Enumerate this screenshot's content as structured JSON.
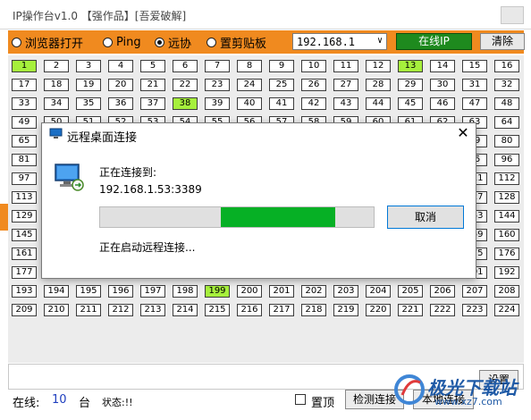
{
  "window": {
    "title": "IP操作台v1.0    【强作品】[吾爱破解]"
  },
  "toolbar": {
    "options": [
      {
        "label": "浏览器打开",
        "selected": false
      },
      {
        "label": "Ping",
        "selected": false
      },
      {
        "label": "远协",
        "selected": true
      },
      {
        "label": "置剪贴板",
        "selected": false
      }
    ],
    "ip_value": "192.168.1",
    "online_label": "在线IP",
    "clear_label": "清除"
  },
  "grid": {
    "online": [
      1,
      13,
      38,
      199
    ]
  },
  "status": {
    "online_label": "在线:",
    "online_count": "10",
    "unit": "台",
    "state_label": "状态:!!",
    "pin_label": "置顶",
    "detect_label": "检测连接",
    "local_label": "本地连接",
    "settings_label": "设置"
  },
  "dialog": {
    "title": "远程桌面连接",
    "connecting_label": "正在连接到:",
    "address": "192.168.1.53:3389",
    "cancel_label": "取消",
    "status_text": "正在启动远程连接...",
    "progress_segment_start": 0.44,
    "progress_segment_end": 0.86
  },
  "watermark": {
    "brand": "极光下载站",
    "url": "www.xz7.com"
  },
  "colors": {
    "toolbar": "#f08a1f",
    "online_cell": "#a6f03c",
    "online_button": "#1e8a1e",
    "progress": "#06b025"
  }
}
